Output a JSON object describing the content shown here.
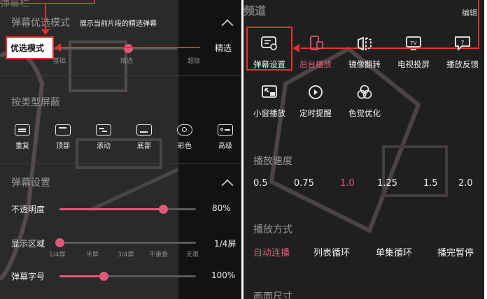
{
  "colors": {
    "accent": "#e05a78",
    "callout": "#e5322d"
  },
  "left": {
    "top_fragment": "弹幕栏",
    "optimize": {
      "title": "弹幕优选模式",
      "subtitle": "展示当前片段的精选弹幕",
      "callout_label": "优选模式",
      "callout_target": "精选",
      "ticks": [
        "基础",
        "精选",
        "超级"
      ],
      "selected_level": 2
    },
    "block_by_type": {
      "title": "按类型屏蔽",
      "items": [
        {
          "label": "重复",
          "icon": "repeat-danmaku-icon"
        },
        {
          "label": "顶部",
          "icon": "top-danmaku-icon"
        },
        {
          "label": "滚动",
          "icon": "scroll-danmaku-icon"
        },
        {
          "label": "底部",
          "icon": "bottom-danmaku-icon"
        },
        {
          "label": "彩色",
          "icon": "color-palette-icon"
        },
        {
          "label": "高级",
          "icon": "advanced-danmaku-icon"
        }
      ]
    },
    "settings": {
      "title": "弹幕设置",
      "opacity": {
        "label": "不透明度",
        "value": "80%",
        "fraction": 0.8
      },
      "area": {
        "label": "显示区域",
        "value": "1/4屏",
        "ticks": [
          "1/4屏",
          "半屏",
          "3/4屏",
          "不重叠",
          "无限"
        ],
        "selected_index": 0
      },
      "font_size": {
        "label": "弹幕字号",
        "value": "100%",
        "fraction": 0.31
      }
    }
  },
  "right": {
    "top_fragment": "频道",
    "edit_label": "编辑",
    "tiles_row1": [
      {
        "label": "弹幕设置",
        "icon": "danmaku-settings-icon",
        "active": false,
        "highlighted": true
      },
      {
        "label": "后台播放",
        "icon": "background-play-icon",
        "active": true
      },
      {
        "label": "镜像翻转",
        "icon": "mirror-flip-icon",
        "active": false
      },
      {
        "label": "电视投屏",
        "icon": "tv-cast-icon",
        "active": false
      },
      {
        "label": "播放反馈",
        "icon": "feedback-icon",
        "active": false
      }
    ],
    "tiles_row2": [
      {
        "label": "小窗播放",
        "icon": "mini-window-icon"
      },
      {
        "label": "定时提醒",
        "icon": "timer-icon"
      },
      {
        "label": "色觉优化",
        "icon": "color-vision-icon"
      }
    ],
    "speed": {
      "title": "播放速度",
      "options": [
        "0.5",
        "0.75",
        "1.0",
        "1.25",
        "1.5",
        "2.0"
      ],
      "selected": "1.0"
    },
    "play_mode": {
      "title": "播放方式",
      "options": [
        "自动连播",
        "列表循环",
        "单集循环",
        "播完暂停"
      ],
      "selected": "自动连播"
    },
    "bottom_fragment": "画面尺寸"
  }
}
